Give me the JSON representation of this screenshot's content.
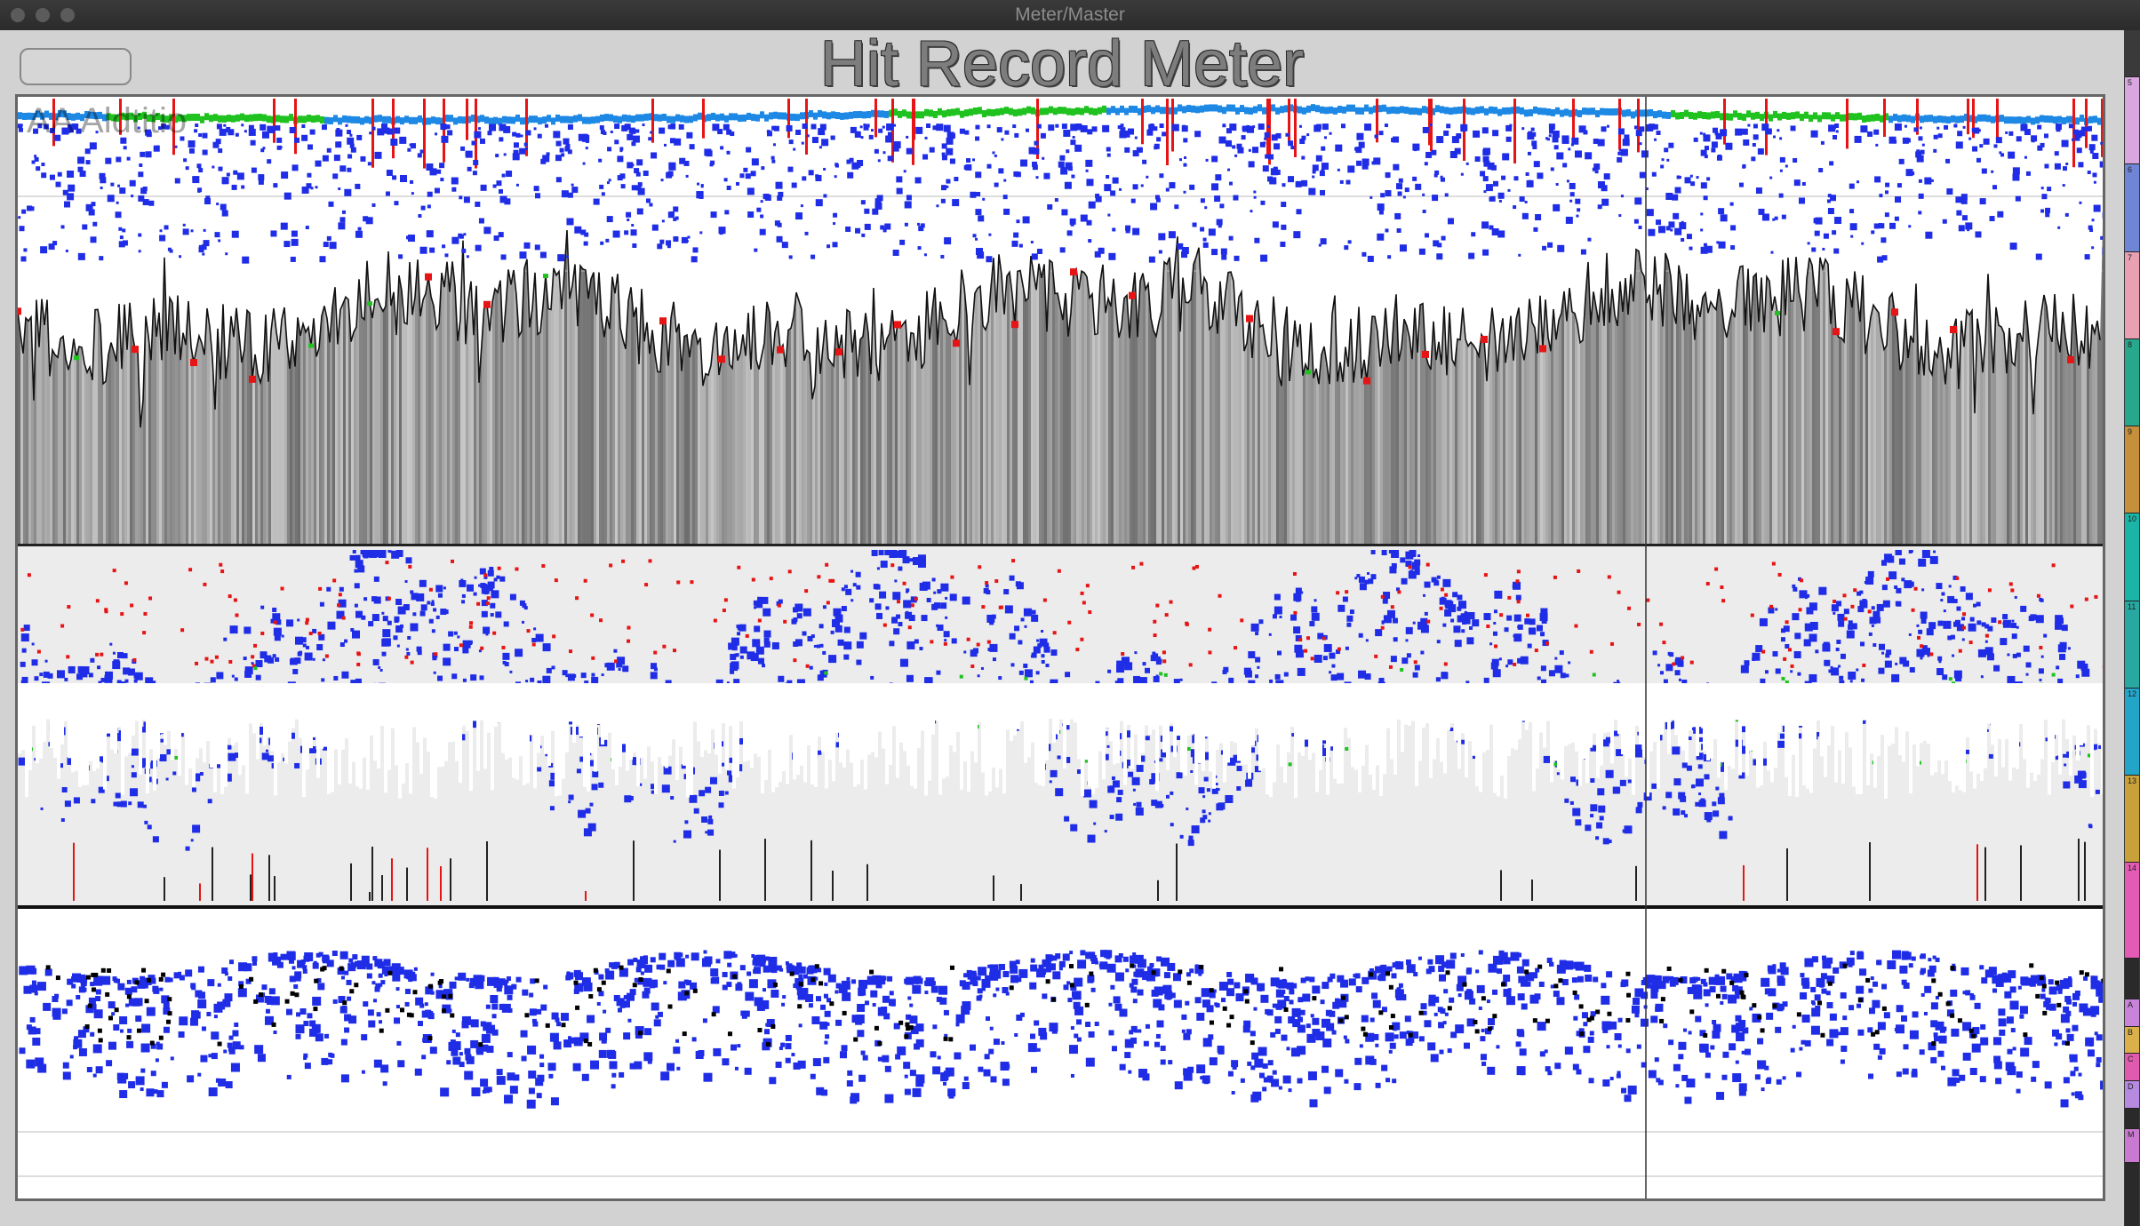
{
  "window": {
    "title": "Meter/Master"
  },
  "meter": {
    "title": "Hit Record Meter",
    "watermark": "AA Aldtitio"
  },
  "right_strip": {
    "segments": [
      {
        "label": "5",
        "color": "#d9a6e0"
      },
      {
        "label": "6",
        "color": "#6f86d6"
      },
      {
        "label": "7",
        "color": "#e8a0b2"
      },
      {
        "label": "8",
        "color": "#27a88c"
      },
      {
        "label": "9",
        "color": "#c68f3c"
      },
      {
        "label": "10",
        "color": "#1bb5a8"
      },
      {
        "label": "11",
        "color": "#27a8a0"
      },
      {
        "label": "12",
        "color": "#23a5c9"
      },
      {
        "label": "13",
        "color": "#c9a13a"
      },
      {
        "label": "14",
        "color": "#e45bb5"
      },
      {
        "label": "",
        "color": "#2a2a2a"
      },
      {
        "label": "A",
        "color": "#c884d8"
      },
      {
        "label": "B",
        "color": "#d9b04a"
      },
      {
        "label": "C",
        "color": "#e05bb0"
      },
      {
        "label": "D",
        "color": "#b58ae0"
      },
      {
        "label": "",
        "color": "#2a2a2a"
      },
      {
        "label": "M",
        "color": "#c97ad0"
      },
      {
        "label": "",
        "color": "#2a2a2a"
      }
    ]
  },
  "colors": {
    "blue": "#1f2de6",
    "red": "#e61414",
    "green": "#1fc21f",
    "light_blue": "#1e88e5",
    "line": "#111111",
    "cursor": "#333333"
  }
}
